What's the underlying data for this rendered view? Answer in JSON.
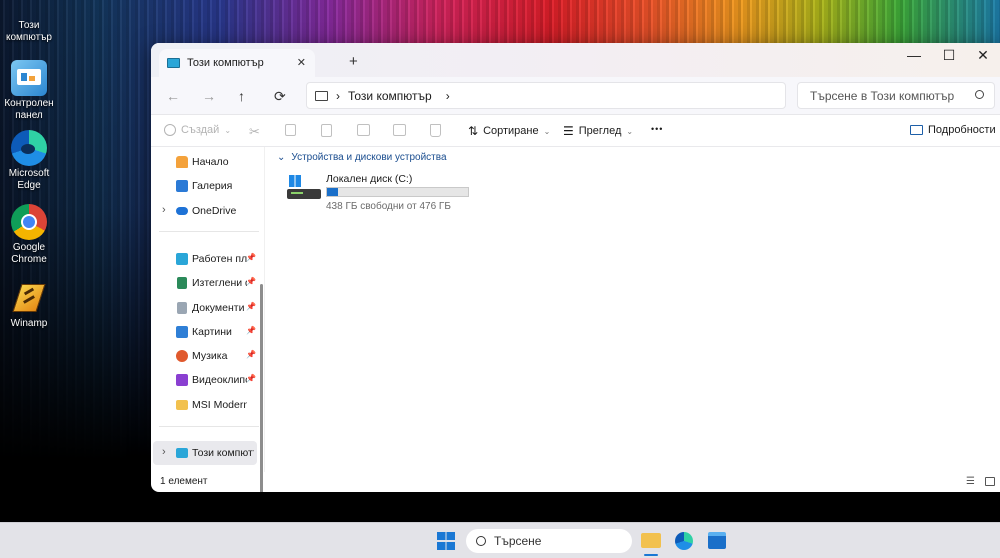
{
  "desktop": {
    "icons": [
      {
        "label": "Този компютър",
        "icon": "monitor-icon"
      },
      {
        "label": "Контролен панел",
        "icon": "control-panel-icon"
      },
      {
        "label": "Microsoft Edge",
        "icon": "edge-icon"
      },
      {
        "label": "Google Chrome",
        "icon": "chrome-icon"
      },
      {
        "label": "Winamp",
        "icon": "winamp-icon"
      }
    ]
  },
  "window": {
    "tab_title": "Този компютър",
    "tab_close": "✕",
    "new_tab": "+",
    "controls": {
      "minimize": "—",
      "maximize": "☐",
      "close": "✕"
    },
    "nav": {
      "back": "←",
      "forward": "→",
      "up": "↑",
      "refresh": "⟳"
    },
    "breadcrumb": {
      "sep": "›",
      "item": "Този компютър",
      "trail": "›"
    },
    "search_placeholder": "Търсене в Този компютър",
    "toolbar": {
      "new": "Създай",
      "sort": "Сортиране",
      "view": "Преглед",
      "more": "•••",
      "details": "Подробности"
    },
    "sidebar": [
      {
        "label": "Начало",
        "icon": "home-icon",
        "color": "#f4a23b"
      },
      {
        "label": "Галерия",
        "icon": "gallery-icon",
        "color": "#2b7ad6"
      },
      {
        "label": "OneDrive",
        "icon": "onedrive-icon",
        "color": "#1e72d6",
        "expand": "›"
      },
      {
        "label": "Работен плот",
        "icon": "desktop-icon",
        "color": "#2aa6d8",
        "pin": "📌"
      },
      {
        "label": "Изтеглени файлове",
        "icon": "downloads-icon",
        "color": "#2b8a5a",
        "pin": "📌"
      },
      {
        "label": "Документи",
        "icon": "documents-icon",
        "color": "#7c8a9a",
        "pin": "📌"
      },
      {
        "label": "Картини",
        "icon": "pictures-icon",
        "color": "#2f7fd6",
        "pin": "📌"
      },
      {
        "label": "Музика",
        "icon": "music-icon",
        "color": "#e0592d",
        "pin": "📌"
      },
      {
        "label": "Видеоклипове",
        "icon": "videos-icon",
        "color": "#8a3fd1",
        "pin": "📌"
      },
      {
        "label": "MSI Modern",
        "icon": "folder-icon",
        "color": "#f2c14e"
      },
      {
        "label": "Този компютър",
        "icon": "this-pc-icon",
        "color": "#2aa6d8",
        "expand": "›"
      }
    ],
    "group_header": "Устройства и дискови устройства",
    "group_chevron": "⌄",
    "drive": {
      "name": "Локален диск (C:)",
      "free": "438 ГБ свободни от 476 ГБ",
      "used_fraction": 0.08,
      "bar_color": "#1a6fc9"
    },
    "status": "1 елемент"
  },
  "taskbar": {
    "search": "Търсене"
  }
}
